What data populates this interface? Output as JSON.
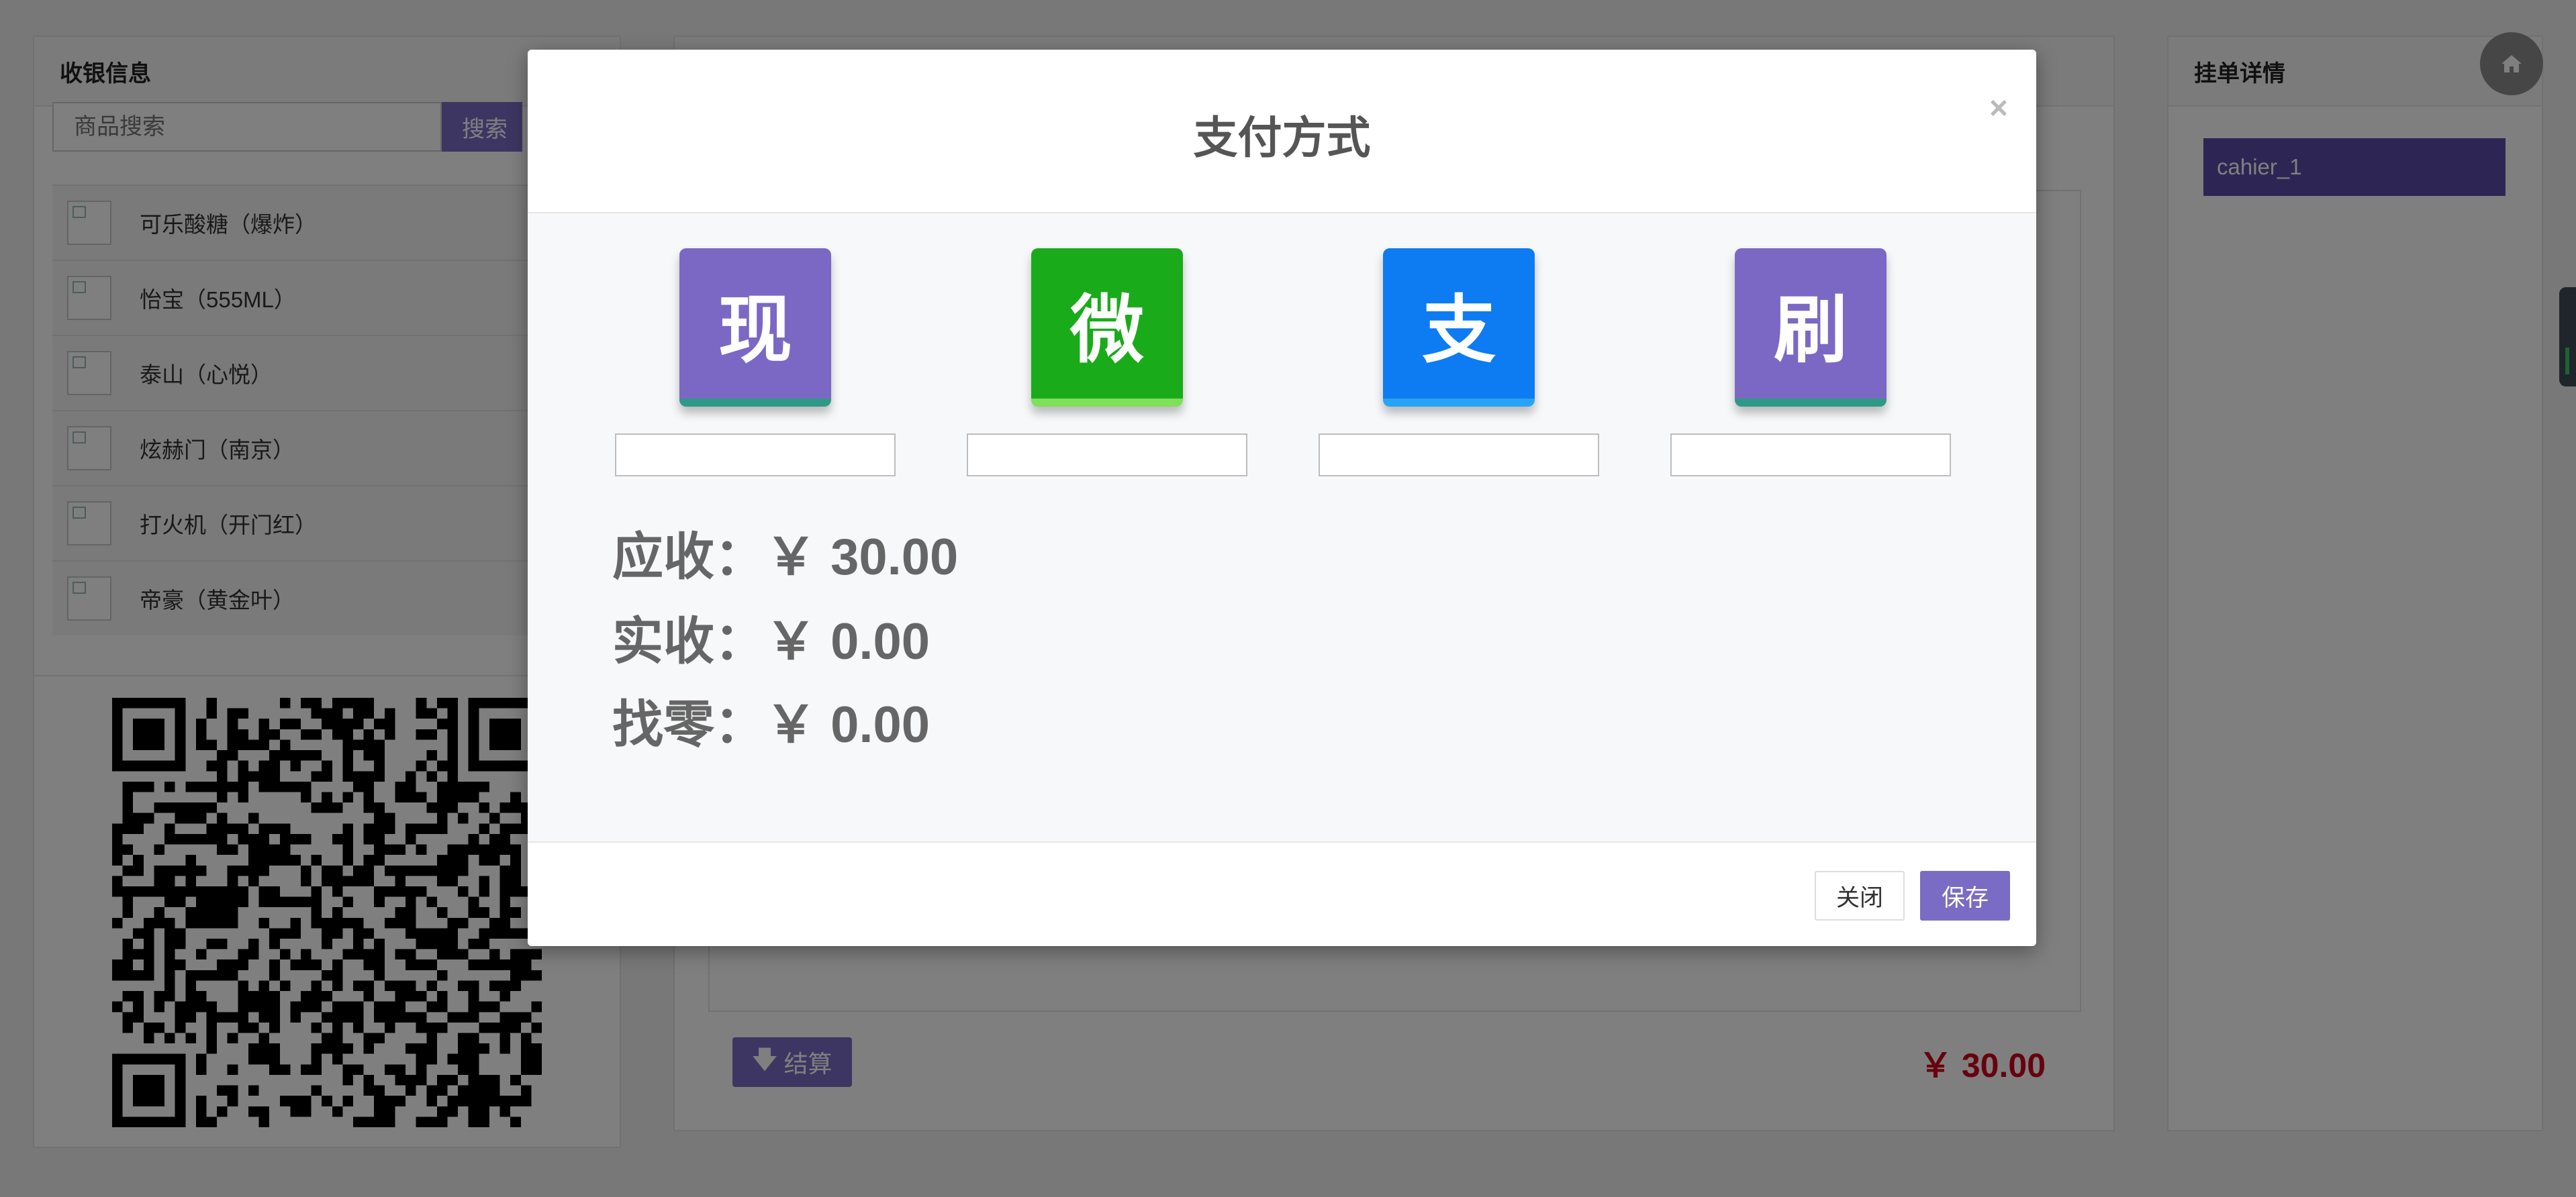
{
  "left_panel": {
    "title": "收银信息",
    "search_placeholder": "商品搜索",
    "search_button": "搜索",
    "products": [
      {
        "name": "可乐酸糖（爆炸）"
      },
      {
        "name": "怡宝（555ML）"
      },
      {
        "name": "泰山（心悦）"
      },
      {
        "name": "炫赫门（南京）"
      },
      {
        "name": "打火机（开门红）"
      },
      {
        "name": "帝豪（黄金叶）"
      }
    ]
  },
  "center_panel": {
    "checkout_button": "结算",
    "checkout_icon": "arrow-down-icon",
    "total": "￥ 30.00"
  },
  "right_panel": {
    "title": "挂单详情",
    "items": [
      "cahier_1"
    ],
    "home_icon": "home-icon"
  },
  "modal": {
    "title": "支付方式",
    "close_symbol": "×",
    "methods": [
      {
        "glyph": "现",
        "color": "#7b68c4",
        "bottom_color": "#2e9a86"
      },
      {
        "glyph": "微",
        "color": "#1aab1a",
        "bottom_color": "#7fe05a"
      },
      {
        "glyph": "支",
        "color": "#0d7cf2",
        "bottom_color": "#29a3f5"
      },
      {
        "glyph": "刷",
        "color": "#7b68c4",
        "bottom_color": "#2e9a86"
      }
    ],
    "receivable": "应收：￥ 30.00",
    "received": "实收：￥ 0.00",
    "change": "找零：￥ 0.00",
    "close_button": "关闭",
    "save_button": "保存"
  }
}
